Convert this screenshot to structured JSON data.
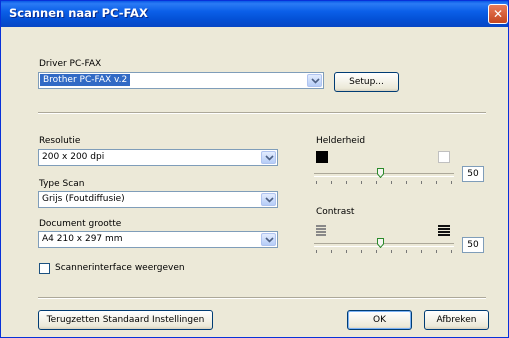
{
  "window": {
    "title": "Scannen naar PC-FAX",
    "close_symbol": "✕"
  },
  "driver": {
    "label": "Driver PC-FAX",
    "selected": "Brother PC-FAX v.2",
    "setup_label": "Setup..."
  },
  "resolution": {
    "label": "Resolutie",
    "selected": "200 x 200 dpi"
  },
  "scan_type": {
    "label": "Type Scan",
    "selected": "Grijs (Foutdiffusie)"
  },
  "document_size": {
    "label": "Document grootte",
    "selected": "A4 210 x 297 mm"
  },
  "scanner_interface": {
    "label": "Scannerinterface weergeven",
    "checked": false
  },
  "brightness": {
    "label": "Helderheid",
    "value": "50"
  },
  "contrast": {
    "label": "Contrast",
    "value": "50"
  },
  "buttons": {
    "reset_label": "Terugzetten Standaard Instellingen",
    "ok_label": "OK",
    "cancel_label": "Afbreken"
  },
  "colors": {
    "titlebar": "#0b5fe8",
    "dialog_bg": "#ece9d8",
    "selection": "#316ac5",
    "close": "#c4461f"
  }
}
